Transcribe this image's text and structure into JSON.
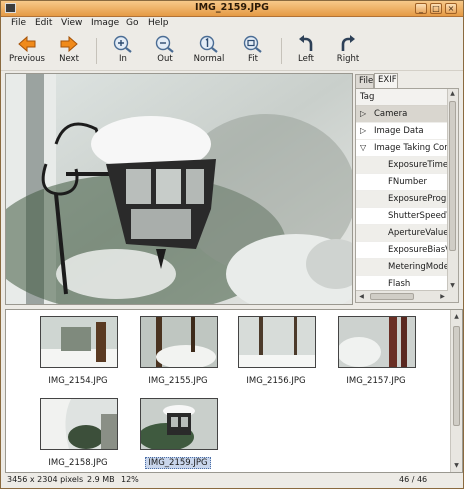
{
  "window": {
    "title": "IMG_2159.JPG",
    "controls": [
      "_",
      "□",
      "×"
    ]
  },
  "menu": [
    "File",
    "Edit",
    "View",
    "Image",
    "Go",
    "Help"
  ],
  "toolbar": {
    "previous": "Previous",
    "next": "Next",
    "zoom_in": "In",
    "zoom_out": "Out",
    "zoom_normal": "Normal",
    "zoom_fit": "Fit",
    "rotate_left": "Left",
    "rotate_right": "Right"
  },
  "side_tabs": [
    "File",
    "EXIF"
  ],
  "exif": {
    "column_header": "Tag",
    "groups": [
      {
        "label": "Camera",
        "expanded": false
      },
      {
        "label": "Image Data",
        "expanded": false
      },
      {
        "label": "Image Taking Conditions",
        "expanded": true
      }
    ],
    "children": [
      "ExposureTime",
      "FNumber",
      "ExposureProgram",
      "ShutterSpeedValue",
      "ApertureValue",
      "ExposureBiasValue",
      "MeteringMode",
      "Flash"
    ]
  },
  "thumbnails": [
    {
      "name": "IMG_2154.JPG",
      "selected": false
    },
    {
      "name": "IMG_2155.JPG",
      "selected": false
    },
    {
      "name": "IMG_2156.JPG",
      "selected": false
    },
    {
      "name": "IMG_2157.JPG",
      "selected": false
    },
    {
      "name": "IMG_2158.JPG",
      "selected": false
    },
    {
      "name": "IMG_2159.JPG",
      "selected": true
    }
  ],
  "status": {
    "dimensions": "3456 x 2304 pixels",
    "size": "2.9 MB",
    "zoom": "12%",
    "position": "46 / 46"
  },
  "colors": {
    "title_bar": "#e9a352",
    "accent_orange": "#f08a1a",
    "selection": "#c9d6ec"
  }
}
